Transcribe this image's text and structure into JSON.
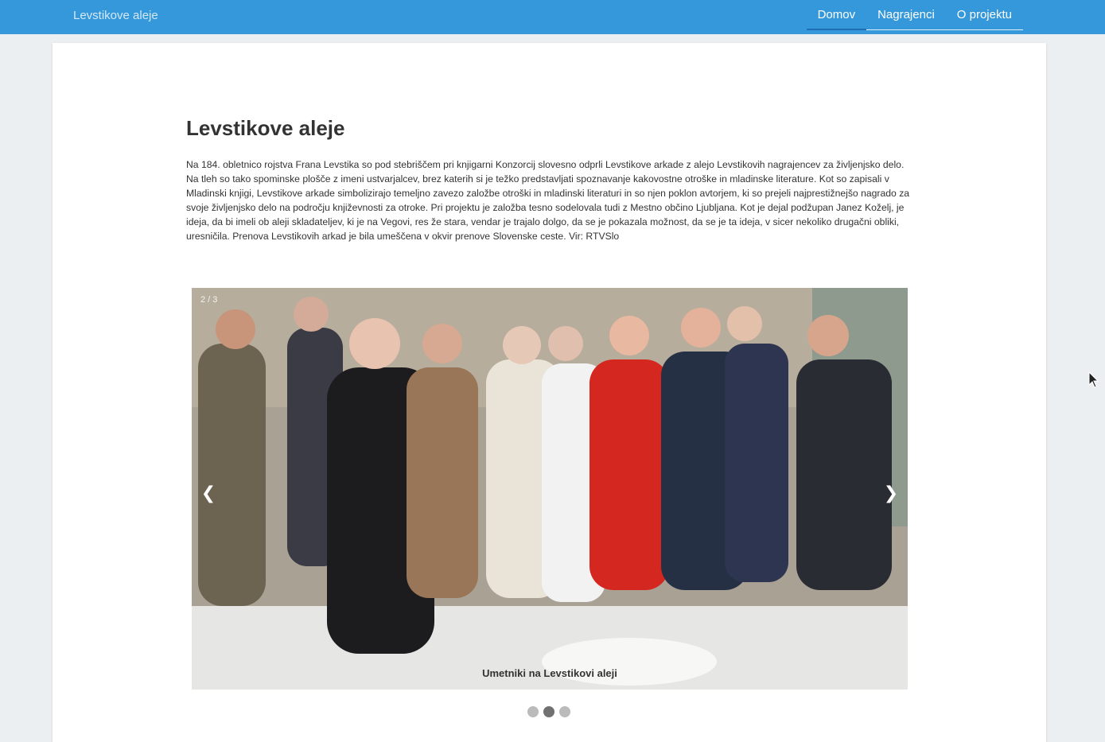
{
  "navbar": {
    "brand": "Levstikove aleje",
    "items": [
      {
        "label": "Domov",
        "active": true
      },
      {
        "label": "Nagrajenci",
        "active": false
      },
      {
        "label": "O projektu",
        "active": false
      }
    ],
    "color": "#3498db"
  },
  "main": {
    "title": "Levstikove aleje",
    "intro": "Na 184. obletnico rojstva Frana Levstika so pod stebriščem pri knjigarni Konzorcij slovesno odprli Levstikove arkade z alejo Levstikovih nagrajencev za življenjsko delo. Na tleh so tako spominske plošče z imeni ustvarjalcev, brez katerih si je težko predstavljati spoznavanje kakovostne otroške in mladinske literature. Kot so zapisali v Mladinski knjigi, Levstikove arkade simbolizirajo temeljno zavezo založbe otroški in mladinski literaturi in so njen poklon avtorjem, ki so prejeli najprestižnejšo nagrado za svoje življenjsko delo na področju književnosti za otroke. Pri projektu je založba tesno sodelovala tudi z Mestno občino Ljubljana. Kot je dejal podžupan Janez Koželj, je ideja, da bi imeli ob aleji skladateljev, ki je na Vegovi, res že stara, vendar je trajalo dolgo, da se je pokazala možnost, da se je ta ideja, v sicer nekoliko drugačni obliki, uresničila. Prenova Levstikovih arkad je bila umeščena v okvir prenove Slovenske ceste. Vir: RTVSlo"
  },
  "slideshow": {
    "counter": "2 / 3",
    "caption": "Umetniki na Levstikovi aleji",
    "prev": "❮",
    "next": "❯",
    "dots": [
      {
        "active": false
      },
      {
        "active": true
      },
      {
        "active": false
      }
    ]
  }
}
